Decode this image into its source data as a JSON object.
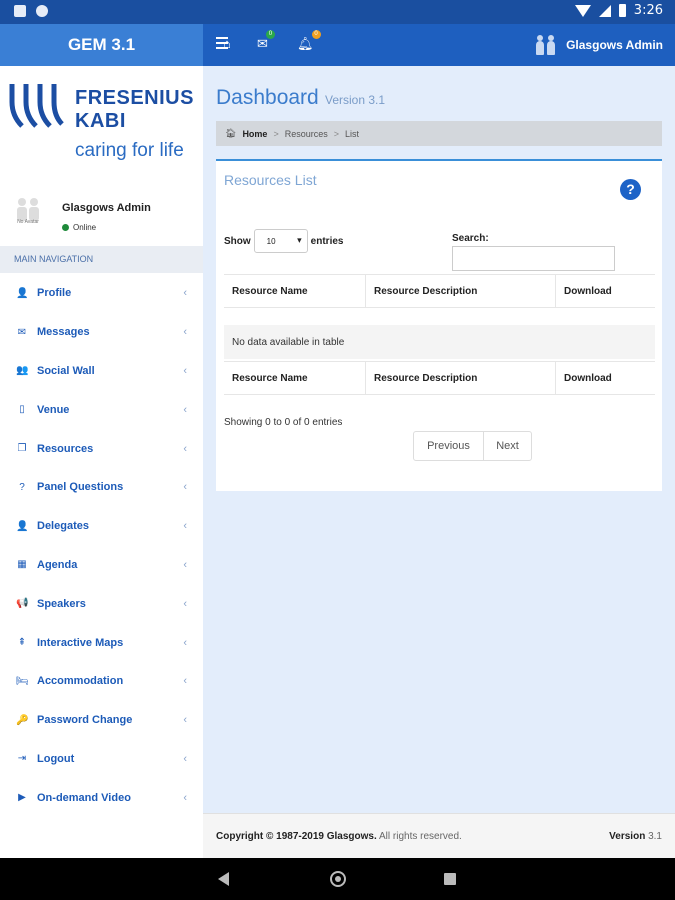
{
  "status_bar": {
    "time": "3:26"
  },
  "header": {
    "app_name": "GEM 3.1",
    "messages_badge": "0",
    "notifications_badge": "0",
    "user": "Glasgows Admin"
  },
  "sidebar": {
    "logo_line1": "FRESENIUS",
    "logo_line2": "KABI",
    "logo_tagline": "caring for life",
    "avatar_label": "No Avatar",
    "user_name": "Glasgows Admin",
    "user_status": "Online",
    "nav_heading": "MAIN NAVIGATION",
    "items": [
      {
        "label": "Profile",
        "icon": "👤"
      },
      {
        "label": "Messages",
        "icon": "✉"
      },
      {
        "label": "Social Wall",
        "icon": "👥"
      },
      {
        "label": "Venue",
        "icon": "▯"
      },
      {
        "label": "Resources",
        "icon": "❐"
      },
      {
        "label": "Panel Questions",
        "icon": "?"
      },
      {
        "label": "Delegates",
        "icon": "👤"
      },
      {
        "label": "Agenda",
        "icon": "▦"
      },
      {
        "label": "Speakers",
        "icon": "📢"
      },
      {
        "label": "Interactive Maps",
        "icon": "⇞"
      },
      {
        "label": "Accommodation",
        "icon": "🛏"
      },
      {
        "label": "Password Change",
        "icon": "🔑"
      },
      {
        "label": "Logout",
        "icon": "⇥"
      },
      {
        "label": "On-demand Video",
        "icon": "▶"
      }
    ],
    "chevron": "‹"
  },
  "main": {
    "title": "Dashboard",
    "subtitle": "Version 3.1",
    "breadcrumb": {
      "home": "Home",
      "sep": ">",
      "level1": "Resources",
      "level2": "List"
    },
    "box_title": "Resources List",
    "show_label": "Show",
    "entries_value": "10",
    "entries_label": "entries",
    "search_label": "Search:",
    "search_value": "",
    "columns": [
      "Resource Name",
      "Resource Description",
      "Download"
    ],
    "empty_message": "No data available in table",
    "info": "Showing 0 to 0 of 0 entries",
    "prev": "Previous",
    "next": "Next"
  },
  "footer": {
    "copyright_bold": "Copyright © 1987-2019 Glasgows.",
    "copyright_rest": "All rights reserved.",
    "version_label": "Version",
    "version_value": "3.1"
  },
  "colors": {
    "header_bg": "#1e5fbf",
    "brand_bg": "#3a7fd5",
    "accent": "#1d5bb8",
    "main_bg": "#e3edfb"
  }
}
